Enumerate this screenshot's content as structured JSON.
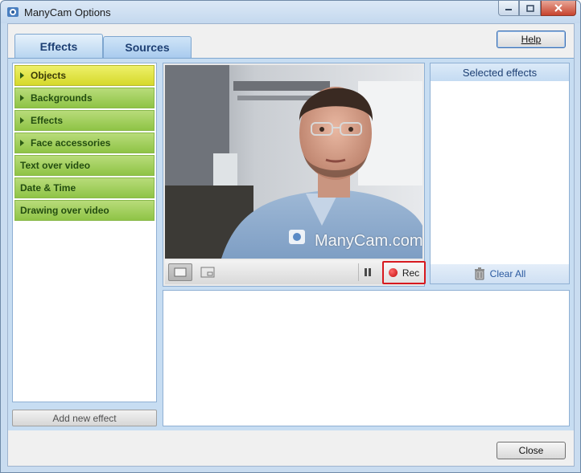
{
  "window": {
    "title": "ManyCam Options"
  },
  "tabs": [
    {
      "label": "Effects",
      "selected": true
    },
    {
      "label": "Sources",
      "selected": false
    }
  ],
  "help_label": "Help",
  "effects": {
    "items": [
      {
        "label": "Objects",
        "expandable": true,
        "active": true
      },
      {
        "label": "Backgrounds",
        "expandable": true,
        "active": false
      },
      {
        "label": "Effects",
        "expandable": true,
        "active": false
      },
      {
        "label": "Face accessories",
        "expandable": true,
        "active": false
      },
      {
        "label": "Text over video",
        "expandable": false,
        "active": false
      },
      {
        "label": "Date & Time",
        "expandable": false,
        "active": false
      },
      {
        "label": "Drawing over video",
        "expandable": false,
        "active": false
      }
    ],
    "add_label": "Add new effect"
  },
  "video": {
    "watermark": "ManyCam.com",
    "rec_label": "Rec"
  },
  "selected_effects": {
    "title": "Selected effects",
    "clear_label": "Clear All"
  },
  "close_label": "Close",
  "colors": {
    "effect_item": "#9ccc57",
    "effect_item_active": "#e4e640",
    "rec_highlight": "#d7191f",
    "tab_text": "#1d3f73"
  }
}
